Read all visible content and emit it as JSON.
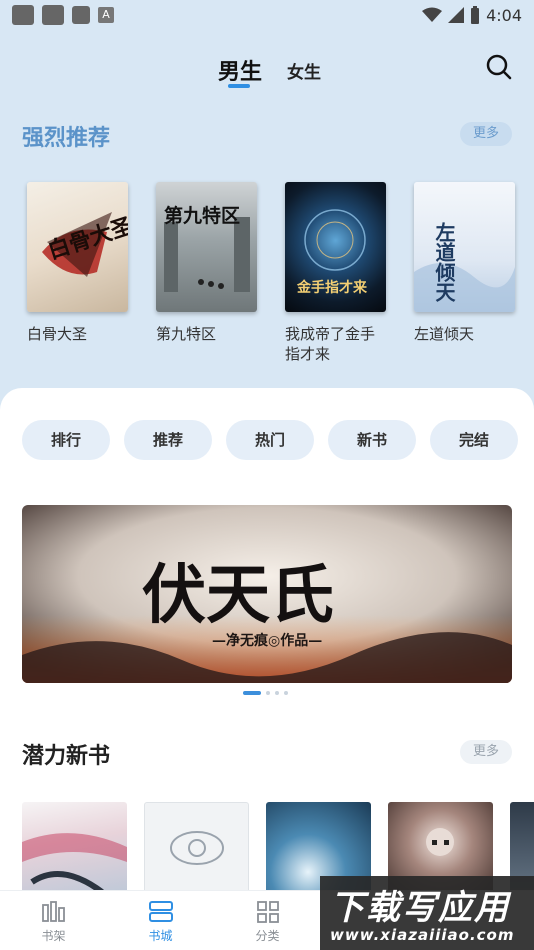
{
  "status_bar": {
    "left_icons": [
      "app-icon",
      "app-icon",
      "square-icon",
      "a-icon"
    ],
    "time": "4:04"
  },
  "top_tabs": {
    "male": "男生",
    "female": "女生",
    "active": "男生"
  },
  "recommend": {
    "title": "强烈推荐",
    "more": "更多",
    "books": [
      {
        "title": "白骨大圣",
        "cover_text": "白骨大圣"
      },
      {
        "title": "第九特区",
        "cover_text": "第九特区"
      },
      {
        "title": "我成帝了金手指才来",
        "cover_text": "金手指才来"
      },
      {
        "title": "左道倾天",
        "cover_text": "左道倾天"
      }
    ]
  },
  "categories": [
    "排行",
    "推荐",
    "热门",
    "新书",
    "完结"
  ],
  "banner": {
    "title": "伏天氏",
    "subtitle": "—净无痕◎作品—"
  },
  "carousel": {
    "count": 4,
    "active": 0
  },
  "new_books": {
    "title": "潜力新书",
    "more": "更多"
  },
  "bottom_nav": [
    {
      "label": "书架",
      "icon": "bookshelf-icon"
    },
    {
      "label": "书城",
      "icon": "bookstore-icon"
    },
    {
      "label": "分类",
      "icon": "grid-icon"
    }
  ],
  "watermark": {
    "cn": "下载写应用",
    "url": "www.xiazaiiiao.com"
  },
  "colors": {
    "accent": "#2f8fe3",
    "header_bg": "#d8e7f4",
    "recommend_title": "#5b93c9"
  }
}
